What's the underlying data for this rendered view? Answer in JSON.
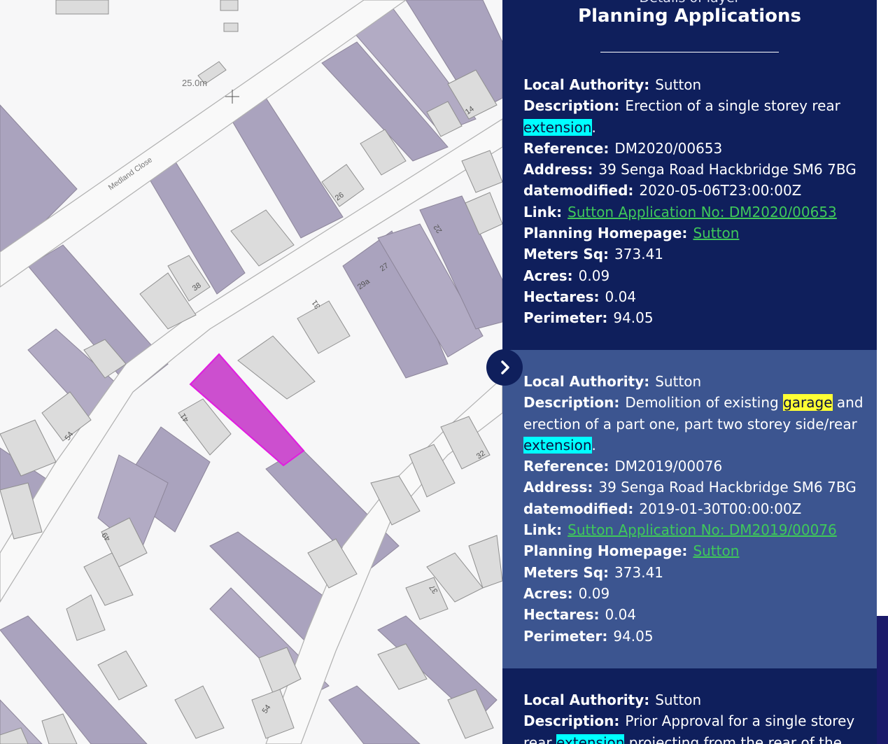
{
  "map": {
    "road_label": "Medland Close",
    "spot_height": "25.0m",
    "house_numbers": [
      "14",
      "26",
      "38",
      "31",
      "29a",
      "27",
      "22",
      "41",
      "54",
      "32",
      "49",
      "37",
      "54"
    ]
  },
  "panel": {
    "subtitle": "Details of layer",
    "title": "Planning Applications",
    "toggle_icon": "chevron-right-icon",
    "records": [
      {
        "local_authority_label": "Local Authority:",
        "local_authority": "Sutton",
        "description_label": "Description:",
        "description_parts": [
          {
            "text": "Erection of a single storey rear ",
            "hl": ""
          },
          {
            "text": "extension",
            "hl": "cyan"
          },
          {
            "text": ".",
            "hl": ""
          }
        ],
        "reference_label": "Reference:",
        "reference": "DM2020/00653",
        "address_label": "Address:",
        "address": "39 Senga Road Hackbridge SM6 7BG",
        "datemodified_label": "datemodified:",
        "datemodified": "2020-05-06T23:00:00Z",
        "link_label": "Link:",
        "link_text": "Sutton Application No: DM2020/00653",
        "homepage_label": "Planning Homepage:",
        "homepage_text": "Sutton",
        "meters_label": "Meters Sq:",
        "meters": "373.41",
        "acres_label": "Acres:",
        "acres": "0.09",
        "hectares_label": "Hectares:",
        "hectares": "0.04",
        "perimeter_label": "Perimeter:",
        "perimeter": "94.05"
      },
      {
        "local_authority_label": "Local Authority:",
        "local_authority": "Sutton",
        "description_label": "Description:",
        "description_parts": [
          {
            "text": "Demolition of existing ",
            "hl": ""
          },
          {
            "text": "garage",
            "hl": "yellow"
          },
          {
            "text": " and erection of a part one, part two storey side/rear ",
            "hl": ""
          },
          {
            "text": "extension",
            "hl": "cyan"
          },
          {
            "text": ".",
            "hl": ""
          }
        ],
        "reference_label": "Reference:",
        "reference": "DM2019/00076",
        "address_label": "Address:",
        "address": "39 Senga Road Hackbridge SM6 7BG",
        "datemodified_label": "datemodified:",
        "datemodified": "2019-01-30T00:00:00Z",
        "link_label": "Link:",
        "link_text": "Sutton Application No: DM2019/00076",
        "homepage_label": "Planning Homepage:",
        "homepage_text": "Sutton",
        "meters_label": "Meters Sq:",
        "meters": "373.41",
        "acres_label": "Acres:",
        "acres": "0.09",
        "hectares_label": "Hectares:",
        "hectares": "0.04",
        "perimeter_label": "Perimeter:",
        "perimeter": "94.05"
      },
      {
        "local_authority_label": "Local Authority:",
        "local_authority": "Sutton",
        "description_label": "Description:",
        "description_parts": [
          {
            "text": "Prior Approval for a single storey rear ",
            "hl": ""
          },
          {
            "text": "extension",
            "hl": "cyan"
          },
          {
            "text": " projecting from the rear of the",
            "hl": ""
          }
        ]
      }
    ]
  },
  "colors": {
    "panel_dark": "#0f1f5c",
    "panel_light": "#3c5590",
    "link": "#3fc95a",
    "highlight_cyan": "#00ffff",
    "highlight_yellow": "#ffff33",
    "selected_parcel": "#cc4fcf",
    "building_purple": "#a9a1bd",
    "building_grey": "#dcdcdc"
  }
}
